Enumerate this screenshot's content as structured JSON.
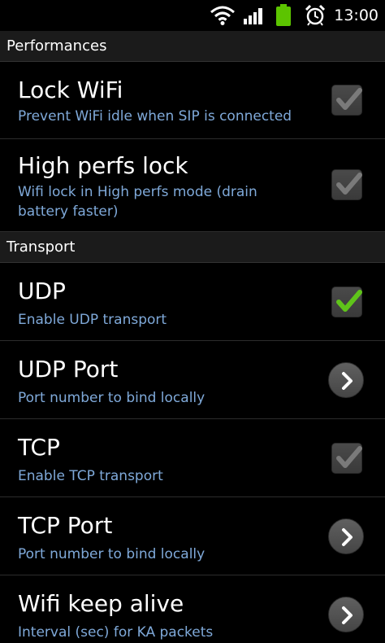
{
  "status_bar": {
    "time": "13:00",
    "icons": [
      "wifi-icon",
      "signal-icon",
      "battery-icon",
      "alarm-icon"
    ],
    "battery_color": "#5cc400"
  },
  "sections": {
    "performances": {
      "header": "Performances",
      "lock_wifi": {
        "title": "Lock WiFi",
        "summary": "Prevent WiFi idle when SIP is connected",
        "checked": false
      },
      "high_perfs_lock": {
        "title": "High perfs lock",
        "summary": "Wifi lock in High perfs mode (drain battery faster)",
        "checked": false
      }
    },
    "transport": {
      "header": "Transport",
      "udp": {
        "title": "UDP",
        "summary": "Enable UDP transport",
        "checked": true
      },
      "udp_port": {
        "title": "UDP Port",
        "summary": "Port number to bind locally"
      },
      "tcp": {
        "title": "TCP",
        "summary": "Enable TCP transport",
        "checked": false
      },
      "tcp_port": {
        "title": "TCP Port",
        "summary": "Port number to bind locally"
      },
      "wifi_keep_alive": {
        "title": "Wifi keep alive",
        "summary": "Interval (sec) for KA packets"
      }
    }
  },
  "colors": {
    "summary_text": "#7fa9d9",
    "check_on": "#5fc41a",
    "check_off": "#7a7a7a"
  }
}
